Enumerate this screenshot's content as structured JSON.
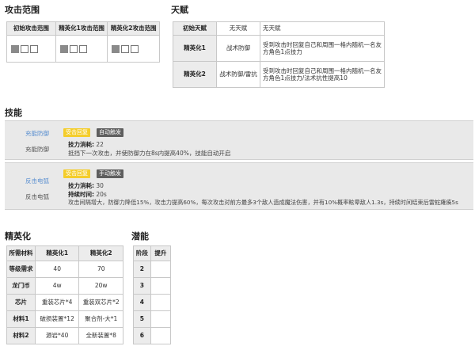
{
  "attack_range": {
    "title": "攻击范围",
    "headers": [
      "初始攻击范围",
      "精英化1攻击范围",
      "精英化2攻击范围"
    ]
  },
  "talent": {
    "title": "天赋",
    "rows": [
      {
        "stage": "初始天赋",
        "name": "无天赋",
        "desc": "无天赋"
      },
      {
        "stage": "精英化1",
        "name": "战术防御",
        "desc": "受到攻击时回复自己和周围一格内随机一名友方角色1点技力"
      },
      {
        "stage": "精英化2",
        "name": "战术防御/雷抗",
        "desc": "受到攻击时回复自己和周围一格内随机一名友方角色1点技力/法术抗性提高10"
      }
    ]
  },
  "skills": {
    "title": "技能",
    "items": [
      {
        "name": "充能防御",
        "sub": "充能防御",
        "tags": [
          "受击回复",
          "自动触发"
        ],
        "sp_label": "技力消耗:",
        "sp_value": "22",
        "desc": "抵挡下一次攻击，并使防御力在8s内提高40%，技能自动开启"
      },
      {
        "name": "反击电弧",
        "sub": "反击电弧",
        "tags": [
          "受击回复",
          "手动触发"
        ],
        "sp_label": "技力消耗:",
        "sp_value": "30",
        "dur_label": "持续时间:",
        "dur_value": "20s",
        "desc": "攻击间隔增大，防御力降低15%，攻击力提高60%，每次攻击对前方最多3个敌人造成魔法伤害，并有10%概率眩晕敌人1.3s，持续时间结束后雷蛇瘫痪5s"
      }
    ]
  },
  "elite": {
    "title": "精英化",
    "headers": [
      "所需材料",
      "精英化1",
      "精英化2"
    ],
    "rows": [
      [
        "等级需求",
        "40",
        "70"
      ],
      [
        "龙门币",
        "4w",
        "20w"
      ],
      [
        "芯片",
        "重装芯片*4",
        "重装双芯片*2"
      ],
      [
        "材料1",
        "破损装置*12",
        "聚合剂-大*1"
      ],
      [
        "材料2",
        "源岩*40",
        "全新装置*8"
      ]
    ]
  },
  "potential": {
    "title": "潜能",
    "headers": [
      "阶段",
      "提升"
    ],
    "rows": [
      "2",
      "3",
      "4",
      "5",
      "6"
    ]
  }
}
